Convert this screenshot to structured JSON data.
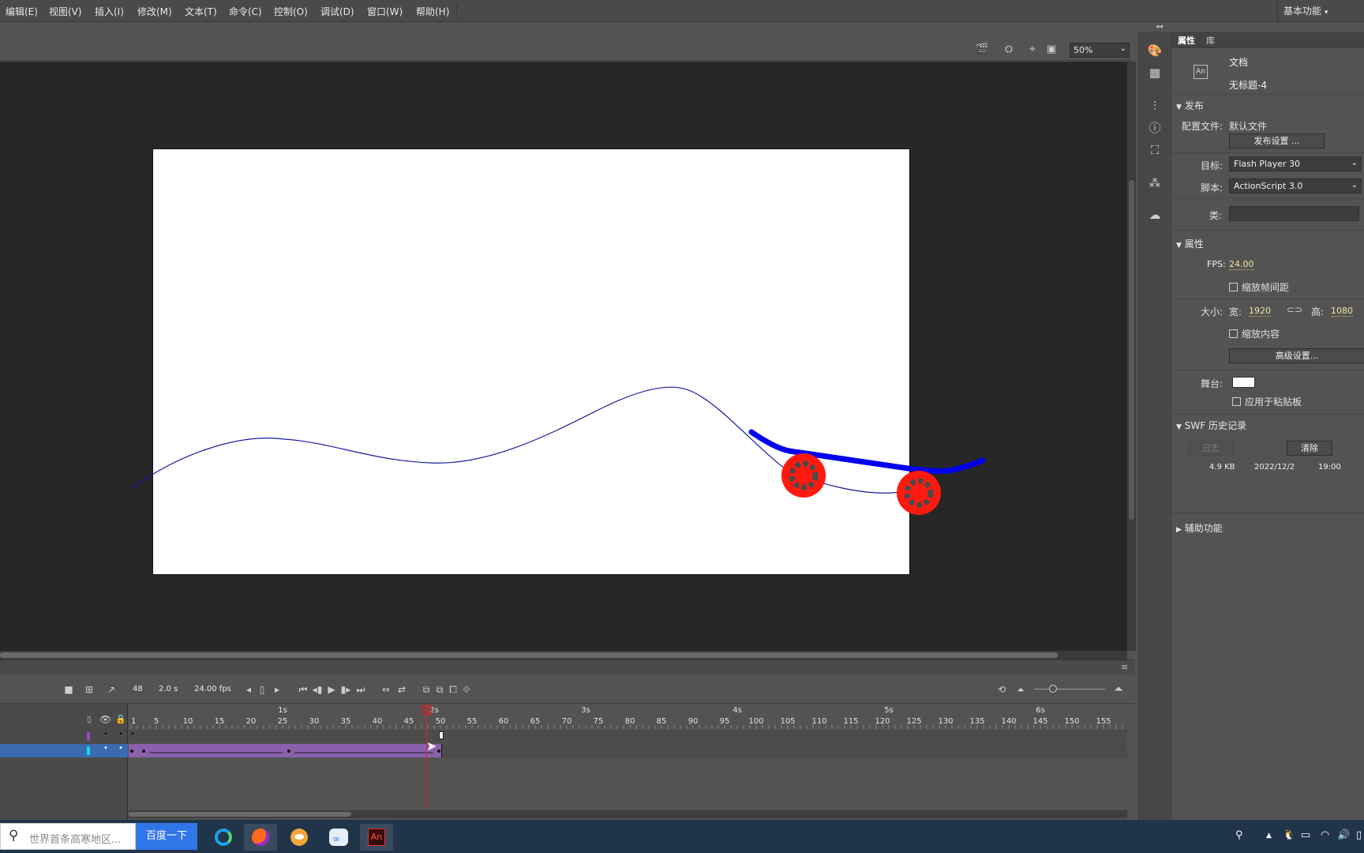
{
  "menubar": {
    "items": [
      "编辑(E)",
      "视图(V)",
      "插入(I)",
      "修改(M)",
      "文本(T)",
      "命令(C)",
      "控制(O)",
      "调试(D)",
      "窗口(W)",
      "帮助(H)"
    ],
    "workspace": "基本功能"
  },
  "stage_toolbar": {
    "zoom": "50%"
  },
  "properties": {
    "tabs": [
      "属性",
      "库"
    ],
    "doc_type": "文档",
    "doc_name": "无标题-4",
    "app_badge": "An",
    "publish": {
      "title": "发布",
      "profile_label": "配置文件:",
      "profile_value": "默认文件",
      "settings_button": "发布设置 ...",
      "target_label": "目标:",
      "target_value": "Flash Player 30",
      "script_label": "脚本:",
      "script_value": "ActionScript 3.0",
      "class_label": "类:",
      "class_value": ""
    },
    "attributes": {
      "title": "属性",
      "fps_label": "FPS:",
      "fps_value": "24.00",
      "scale_spans": "缩放帧间距",
      "size_label": "大小:",
      "width_label": "宽:",
      "width_value": "1920",
      "height_label": "高:",
      "height_value": "1080",
      "scale_content": "缩放内容",
      "advanced_button": "高级设置...",
      "stage_label": "舞台:",
      "stage_color": "#FFFFFF",
      "apply_pasteboard": "应用于粘贴板"
    },
    "swf_history": {
      "title": "SWF 历史记录",
      "log_button": "日志",
      "clear_button": "清除",
      "size": "4.9 KB",
      "date": "2022/12/2",
      "time": "19:00"
    },
    "accessibility": {
      "title": "辅助功能"
    }
  },
  "timeline": {
    "current_frame": "48",
    "time": "2.0 s",
    "fps": "24.00 fps",
    "second_marks": [
      "1s",
      "2s",
      "3s",
      "4s",
      "5s",
      "6s"
    ],
    "frame_numbers": [
      "1",
      "5",
      "10",
      "15",
      "20",
      "25",
      "30",
      "35",
      "40",
      "45",
      "50",
      "55",
      "60",
      "65",
      "70",
      "75",
      "80",
      "85",
      "90",
      "95",
      "100",
      "105",
      "110",
      "115",
      "120",
      "125",
      "130",
      "135",
      "140",
      "145",
      "150",
      "155"
    ],
    "layers": [
      {
        "color": "#9b44c9",
        "selected": false
      },
      {
        "color": "#19d3ee",
        "selected": true
      }
    ]
  },
  "taskbar": {
    "search_placeholder": "世界首条高寒地区...",
    "search_button": "百度一下",
    "apps": [
      "edge-icon",
      "firefox-icon",
      "bird-app-icon",
      "baidu-netdisk-icon",
      "animate-icon"
    ],
    "animate_label": "An"
  },
  "colors": {
    "path": "#1a1aa0",
    "skateboard": "#0000ee",
    "wheel": "#ff1a10",
    "playhead": "#e02020",
    "tween": "#8a60ad"
  }
}
